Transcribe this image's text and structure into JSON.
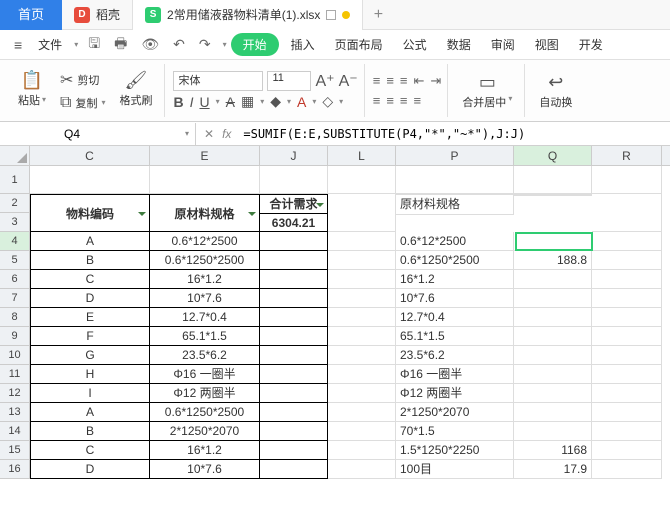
{
  "titlebar": {
    "home_tab": "首页",
    "docshell_tab": "稻壳",
    "file_tab": "2常用储液器物料清单(1).xlsx",
    "newtab": "+"
  },
  "menubar": {
    "file_menu": "文件",
    "start": "开始",
    "insert": "插入",
    "page_layout": "页面布局",
    "formulas": "公式",
    "data": "数据",
    "review": "审阅",
    "view": "视图",
    "developer": "开发"
  },
  "ribbon": {
    "cut": "剪切",
    "paste": "粘贴",
    "copy": "复制",
    "format_painter": "格式刷",
    "font_name": "宋体",
    "font_size": "11",
    "merge_center": "合并居中",
    "auto_wrap": "自动换"
  },
  "namebox": "Q4",
  "formula": "=SUMIF(E:E,SUBSTITUTE(P4,\"*\",\"~*\"),J:J)",
  "columns": [
    "C",
    "E",
    "J",
    "L",
    "P",
    "Q",
    "R"
  ],
  "rownums": [
    "1",
    "2",
    "3",
    "4",
    "5",
    "6",
    "7",
    "8",
    "9",
    "10",
    "11",
    "12",
    "13",
    "14",
    "15",
    "16"
  ],
  "headers": {
    "c": "物料编码",
    "e": "原材料规格",
    "j_top": "合计需求",
    "j_val": "6304.21",
    "p": "原材料规格"
  },
  "table_left": [
    {
      "c": "A",
      "e": "0.6*12*2500"
    },
    {
      "c": "B",
      "e": "0.6*1250*2500"
    },
    {
      "c": "C",
      "e": "16*1.2"
    },
    {
      "c": "D",
      "e": "10*7.6"
    },
    {
      "c": "E",
      "e": "12.7*0.4"
    },
    {
      "c": "F",
      "e": "65.1*1.5"
    },
    {
      "c": "G",
      "e": "23.5*6.2"
    },
    {
      "c": "H",
      "e": "Φ16 一圈半"
    },
    {
      "c": "I",
      "e": "Φ12 两圈半"
    },
    {
      "c": "A",
      "e": "0.6*1250*2500"
    },
    {
      "c": "B",
      "e": "2*1250*2070"
    },
    {
      "c": "C",
      "e": "16*1.2"
    },
    {
      "c": "D",
      "e": "10*7.6"
    }
  ],
  "table_right": [
    {
      "p": "0.6*12*2500",
      "q": ""
    },
    {
      "p": "0.6*1250*2500",
      "q": "188.8"
    },
    {
      "p": "16*1.2",
      "q": ""
    },
    {
      "p": "10*7.6",
      "q": ""
    },
    {
      "p": "12.7*0.4",
      "q": ""
    },
    {
      "p": "65.1*1.5",
      "q": ""
    },
    {
      "p": "23.5*6.2",
      "q": ""
    },
    {
      "p": "Φ16 一圈半",
      "q": ""
    },
    {
      "p": "Φ12 两圈半",
      "q": ""
    },
    {
      "p": "2*1250*2070",
      "q": ""
    },
    {
      "p": "70*1.5",
      "q": ""
    },
    {
      "p": "1.5*1250*2250",
      "q": "1168"
    },
    {
      "p": "100目",
      "q": "17.9"
    }
  ]
}
